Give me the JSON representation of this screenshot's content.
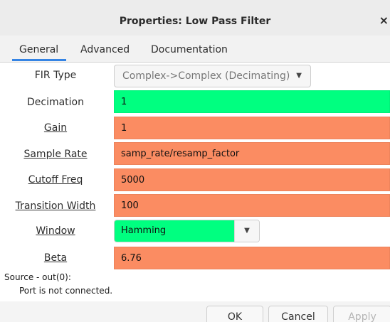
{
  "window": {
    "title": "Properties: Low Pass Filter",
    "close_glyph": "×"
  },
  "tabs": [
    {
      "label": "General",
      "active": true
    },
    {
      "label": "Advanced",
      "active": false
    },
    {
      "label": "Documentation",
      "active": false
    }
  ],
  "fields": {
    "fir_type": {
      "label": "FIR Type",
      "value": "Complex->Complex (Decimating)"
    },
    "decimation": {
      "label": "Decimation",
      "value": "1"
    },
    "gain": {
      "label": "Gain",
      "value": "1"
    },
    "sample_rate": {
      "label": "Sample Rate",
      "value": "samp_rate/resamp_factor"
    },
    "cutoff_freq": {
      "label": "Cutoff Freq",
      "value": "5000"
    },
    "transition_width": {
      "label": "Transition Width",
      "value": "100"
    },
    "window": {
      "label": "Window",
      "value": "Hamming"
    },
    "beta": {
      "label": "Beta",
      "value": "6.76"
    }
  },
  "messages": {
    "source": "Source - out(0):",
    "detail": "Port is not connected."
  },
  "buttons": {
    "ok": "OK",
    "cancel": "Cancel",
    "apply": "Apply"
  },
  "colors": {
    "valid_green": "#00ff80",
    "error_orange": "#fb8c62",
    "tab_accent": "#3584e4"
  },
  "icons": {
    "dropdown": "chevron-down-icon",
    "close": "close-icon"
  }
}
